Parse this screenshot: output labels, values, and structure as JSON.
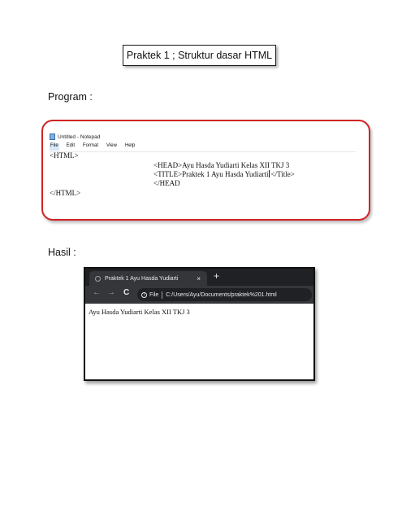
{
  "heading": "Praktek 1 ; Struktur dasar HTML",
  "program_label": "Program :",
  "hasil_label": "Hasil :",
  "notepad": {
    "window_title": "Untitled - Notepad",
    "menu": [
      "File",
      "Edit",
      "Format",
      "View",
      "Help"
    ],
    "lines": [
      "<HTML>",
      "<HEAD>Ayu Hasda Yudiarti Kelas XII TKJ 3",
      "<TITLE>Praktek 1 Ayu Hasda Yudiarti",
      "</Title>",
      "</HEAD",
      "</HTML>"
    ]
  },
  "browser": {
    "tab_title": "Praktek 1 Ayu Hasda Yudiarti",
    "tab_close": "×",
    "new_tab": "+",
    "nav_back": "←",
    "nav_forward": "→",
    "nav_reload": "C",
    "info_icon": "i",
    "url_scheme": "File",
    "url": "C:/Users/Ayu/Documents/praktek%201.html",
    "page_text": "Ayu Hasda Yudiarti Kelas XII TKJ 3"
  }
}
